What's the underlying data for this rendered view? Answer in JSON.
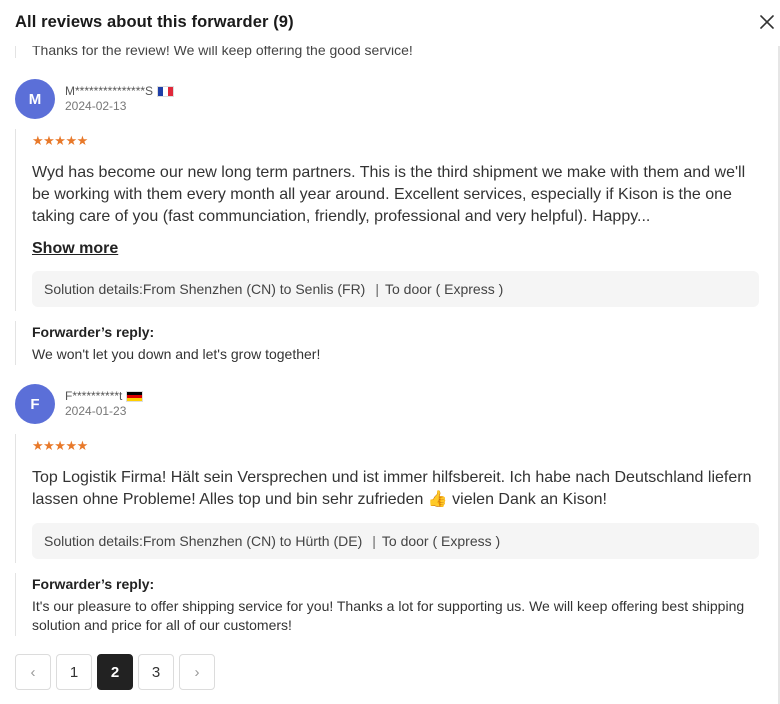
{
  "dialog": {
    "title": "All reviews about this forwarder (9)"
  },
  "previous_reply": {
    "text": "Thanks for the review! We will keep offering the good service!"
  },
  "reviews": [
    {
      "avatar_letter": "M",
      "username": "M***************S",
      "country": "FR",
      "date": "2024-02-13",
      "stars": "★★★★★",
      "rating": 5,
      "text": "Wyd has become our new long term partners. This is the third shipment we make with them and we'll be working with them every month all year around. Excellent services, especially if Kison is the one taking care of you (fast communciation, friendly, professional and very helpful). Happy...",
      "show_more": "Show more",
      "solution_prefix": "Solution details:",
      "solution_route": "From Shenzhen (CN) to Senlis (FR)",
      "solution_sep": "|",
      "solution_service": "To door ( Express )",
      "reply_label": "Forwarder’s reply:",
      "reply_text": "We won't let you down and let's grow together!"
    },
    {
      "avatar_letter": "F",
      "username": "F**********t",
      "country": "DE",
      "date": "2024-01-23",
      "stars": "★★★★★",
      "rating": 5,
      "text": "Top Logistik Firma! Hält sein Versprechen und ist immer hilfsbereit. Ich habe nach Deutschland liefern lassen ohne Probleme! Alles top und bin sehr zufrieden 👍 vielen Dank an Kison!",
      "solution_prefix": "Solution details:",
      "solution_route": "From Shenzhen (CN) to Hürth (DE)",
      "solution_sep": "|",
      "solution_service": "To door ( Express )",
      "reply_label": "Forwarder’s reply:",
      "reply_text": "It's our pleasure to offer shipping service for you! Thanks a lot for supporting us. We will keep offering best shipping solution and price for all of our customers!"
    }
  ],
  "pagination": {
    "prev_icon": "‹",
    "next_icon": "›",
    "pages": [
      "1",
      "2",
      "3"
    ],
    "current": "2"
  },
  "colors": {
    "accent_avatar": "#5b6fd8",
    "star": "#e8792a",
    "active_page": "#222222"
  }
}
